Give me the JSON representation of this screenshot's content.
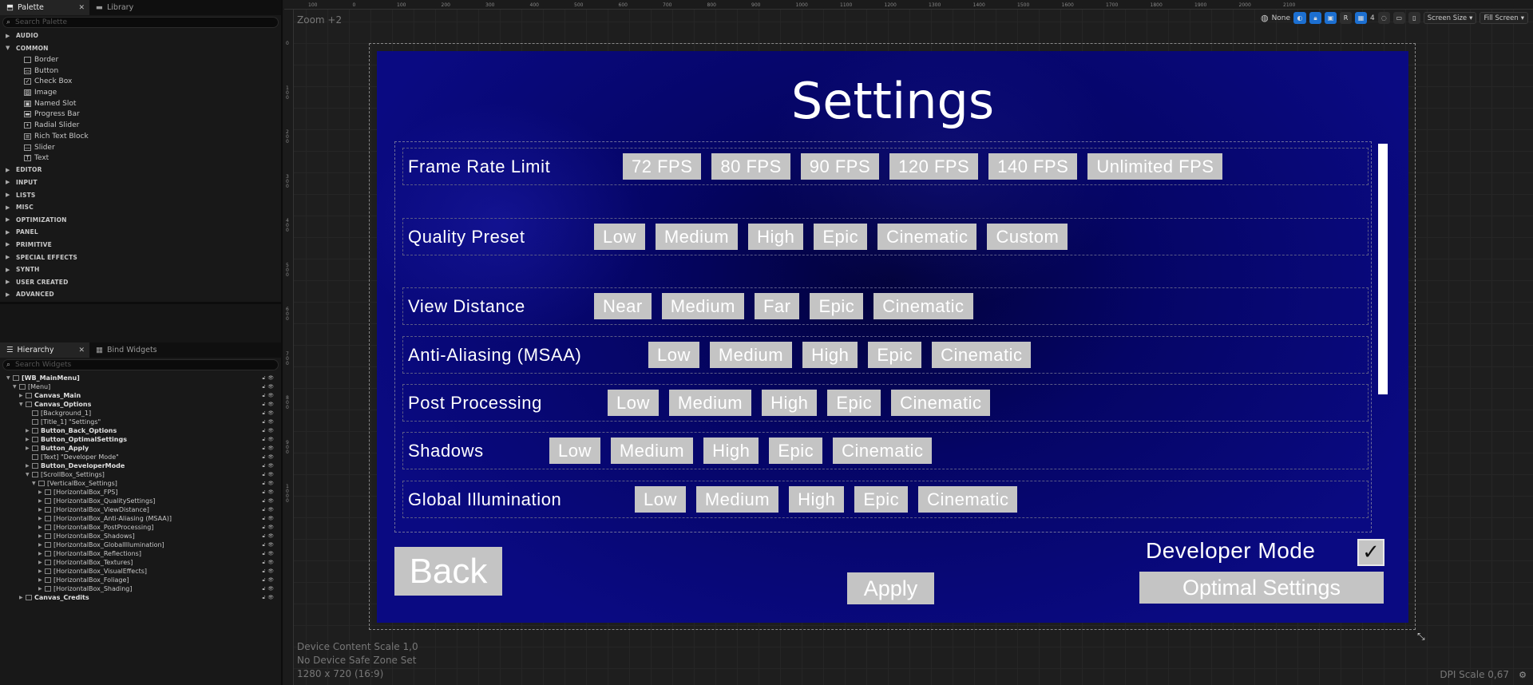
{
  "palette": {
    "tabs": [
      {
        "label": "Palette"
      },
      {
        "label": "Library"
      }
    ],
    "search_placeholder": "Search Palette",
    "categories_top": [
      {
        "label": "AUDIO"
      },
      {
        "label": "COMMON"
      }
    ],
    "common_items": [
      {
        "label": "Border",
        "icon": "border-icon"
      },
      {
        "label": "Button",
        "icon": "button-icon"
      },
      {
        "label": "Check Box",
        "icon": "checkbox-icon"
      },
      {
        "label": "Image",
        "icon": "image-icon"
      },
      {
        "label": "Named Slot",
        "icon": "named-slot-icon"
      },
      {
        "label": "Progress Bar",
        "icon": "progress-bar-icon"
      },
      {
        "label": "Radial Slider",
        "icon": "radial-slider-icon"
      },
      {
        "label": "Rich Text Block",
        "icon": "rich-text-icon"
      },
      {
        "label": "Slider",
        "icon": "slider-icon"
      },
      {
        "label": "Text",
        "icon": "text-icon"
      }
    ],
    "categories_bottom": [
      {
        "label": "EDITOR"
      },
      {
        "label": "INPUT"
      },
      {
        "label": "LISTS"
      },
      {
        "label": "MISC"
      },
      {
        "label": "OPTIMIZATION"
      },
      {
        "label": "PANEL"
      },
      {
        "label": "PRIMITIVE"
      },
      {
        "label": "SPECIAL EFFECTS"
      },
      {
        "label": "SYNTH"
      },
      {
        "label": "USER CREATED"
      },
      {
        "label": "ADVANCED"
      }
    ]
  },
  "hierarchy": {
    "tabs": [
      {
        "label": "Hierarchy"
      },
      {
        "label": "Bind Widgets"
      }
    ],
    "search_placeholder": "Search Widgets",
    "rows": [
      {
        "label": "[WB_MainMenu]",
        "bold": true,
        "indent": 0,
        "expanded": true
      },
      {
        "label": "[Menu]",
        "bold": false,
        "indent": 1,
        "expanded": true
      },
      {
        "label": "Canvas_Main",
        "bold": true,
        "indent": 2,
        "expanded": false
      },
      {
        "label": "Canvas_Options",
        "bold": true,
        "indent": 2,
        "expanded": true
      },
      {
        "label": "[Background_1]",
        "bold": false,
        "indent": 3,
        "expanded": null
      },
      {
        "label": "[Title_1] \"Settings\"",
        "bold": false,
        "indent": 3,
        "expanded": null
      },
      {
        "label": "Button_Back_Options",
        "bold": true,
        "indent": 3,
        "expanded": false
      },
      {
        "label": "Button_OptimalSettings",
        "bold": true,
        "indent": 3,
        "expanded": false
      },
      {
        "label": "Button_Apply",
        "bold": true,
        "indent": 3,
        "expanded": false
      },
      {
        "label": "[Text] \"Developer Mode\"",
        "bold": false,
        "indent": 3,
        "expanded": null
      },
      {
        "label": "Button_DeveloperMode",
        "bold": true,
        "indent": 3,
        "expanded": false
      },
      {
        "label": "[ScrollBox_Settings]",
        "bold": false,
        "indent": 3,
        "expanded": true
      },
      {
        "label": "[VerticalBox_Settings]",
        "bold": false,
        "indent": 4,
        "expanded": true
      },
      {
        "label": "[HorizontalBox_FPS]",
        "bold": false,
        "indent": 5,
        "expanded": false
      },
      {
        "label": "[HorizontalBox_QualitySettings]",
        "bold": false,
        "indent": 5,
        "expanded": false
      },
      {
        "label": "[HorizontalBox_ViewDistance]",
        "bold": false,
        "indent": 5,
        "expanded": false
      },
      {
        "label": "[HorizontalBox_Anti-Aliasing (MSAA)]",
        "bold": false,
        "indent": 5,
        "expanded": false
      },
      {
        "label": "[HorizontalBox_PostProcessing]",
        "bold": false,
        "indent": 5,
        "expanded": false
      },
      {
        "label": "[HorizontalBox_Shadows]",
        "bold": false,
        "indent": 5,
        "expanded": false
      },
      {
        "label": "[HorizontalBox_GlobalIllumination]",
        "bold": false,
        "indent": 5,
        "expanded": false
      },
      {
        "label": "[HorizontalBox_Reflections]",
        "bold": false,
        "indent": 5,
        "expanded": false
      },
      {
        "label": "[HorizontalBox_Textures]",
        "bold": false,
        "indent": 5,
        "expanded": false
      },
      {
        "label": "[HorizontalBox_VisualEffects]",
        "bold": false,
        "indent": 5,
        "expanded": false
      },
      {
        "label": "[HorizontalBox_Foliage]",
        "bold": false,
        "indent": 5,
        "expanded": false
      },
      {
        "label": "[HorizontalBox_Shading]",
        "bold": false,
        "indent": 5,
        "expanded": false
      },
      {
        "label": "Canvas_Credits",
        "bold": true,
        "indent": 2,
        "expanded": false
      }
    ]
  },
  "viewport": {
    "zoom": "Zoom +2",
    "ruler_top": [
      "100",
      "0",
      "100",
      "200",
      "300",
      "400",
      "500",
      "600",
      "700",
      "800",
      "900",
      "1000",
      "1100",
      "1200",
      "1300",
      "1400",
      "1500",
      "1600",
      "1700",
      "1800",
      "1900",
      "2000",
      "2100"
    ],
    "ruler_left": [
      "0",
      "100",
      "200",
      "300",
      "400",
      "500",
      "600",
      "700",
      "800",
      "900",
      "1000"
    ],
    "toolbar": {
      "localization": "None",
      "grid_snap": "4",
      "respect_locks": "R",
      "screen_size": "Screen Size",
      "fill_mode": "Fill Screen"
    },
    "info": [
      "Device Content Scale 1,0",
      "No Device Safe Zone Set",
      "1280 x 720 (16:9)"
    ],
    "dpi_scale": "DPI Scale 0,67"
  },
  "game_ui": {
    "title": "Settings",
    "rows": [
      {
        "label": "Frame Rate Limit",
        "options": [
          "72 FPS",
          "80 FPS",
          "90 FPS",
          "120 FPS",
          "140 FPS",
          "Unlimited FPS"
        ]
      },
      {
        "label": "Quality Preset",
        "options": [
          "Low",
          "Medium",
          "High",
          "Epic",
          "Cinematic",
          "Custom"
        ]
      },
      {
        "label": "View Distance",
        "options": [
          "Near",
          "Medium",
          "Far",
          "Epic",
          "Cinematic"
        ]
      },
      {
        "label": "Anti-Aliasing (MSAA)",
        "options": [
          "Low",
          "Medium",
          "High",
          "Epic",
          "Cinematic"
        ]
      },
      {
        "label": "Post Processing",
        "options": [
          "Low",
          "Medium",
          "High",
          "Epic",
          "Cinematic"
        ]
      },
      {
        "label": "Shadows",
        "options": [
          "Low",
          "Medium",
          "High",
          "Epic",
          "Cinematic"
        ]
      },
      {
        "label": "Global Illumination",
        "options": [
          "Low",
          "Medium",
          "High",
          "Epic",
          "Cinematic"
        ]
      }
    ],
    "back_label": "Back",
    "apply_label": "Apply",
    "developer_mode_label": "Developer Mode",
    "developer_mode_checked": true,
    "optimal_label": "Optimal Settings"
  },
  "colors": {
    "accent": "#1c6fd1",
    "button_fill": "#c4c4c4",
    "canvas_bg": "#050566"
  }
}
